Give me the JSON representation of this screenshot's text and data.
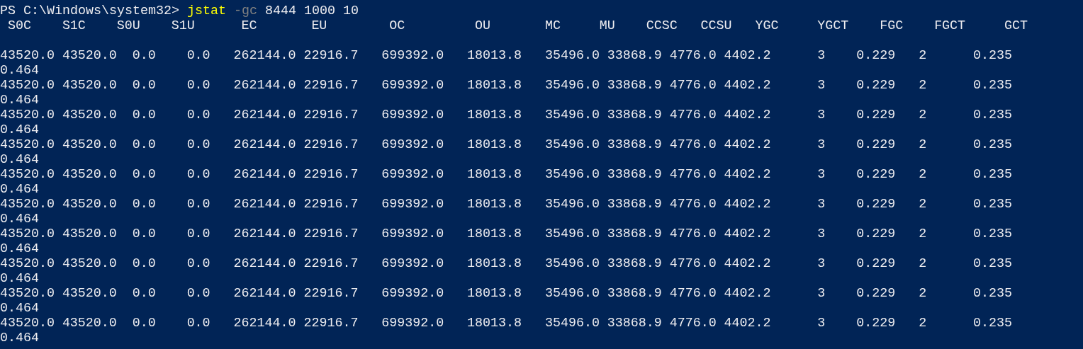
{
  "prompt": {
    "path": "PS C:\\Windows\\system32>",
    "command": "jstat",
    "parameter": "-gc",
    "arguments": "8444 1000 10"
  },
  "output": {
    "header_fields": [
      "S0C",
      "S1C",
      "S0U",
      "S1U",
      "EC",
      "EU",
      "OC",
      "OU",
      "MC",
      "MU",
      "CCSC",
      "CCSU",
      "YGC",
      "YGCT",
      "FGC",
      "FGCT",
      "GCT"
    ],
    "records": [
      [
        "43520.0",
        "43520.0",
        "0.0",
        "0.0",
        "262144.0",
        "22916.7",
        "699392.0",
        "18013.8",
        "35496.0",
        "33868.9",
        "4776.0",
        "4402.2",
        "3",
        "0.229",
        "2",
        "0.235",
        "0.464"
      ],
      [
        "43520.0",
        "43520.0",
        "0.0",
        "0.0",
        "262144.0",
        "22916.7",
        "699392.0",
        "18013.8",
        "35496.0",
        "33868.9",
        "4776.0",
        "4402.2",
        "3",
        "0.229",
        "2",
        "0.235",
        "0.464"
      ],
      [
        "43520.0",
        "43520.0",
        "0.0",
        "0.0",
        "262144.0",
        "22916.7",
        "699392.0",
        "18013.8",
        "35496.0",
        "33868.9",
        "4776.0",
        "4402.2",
        "3",
        "0.229",
        "2",
        "0.235",
        "0.464"
      ],
      [
        "43520.0",
        "43520.0",
        "0.0",
        "0.0",
        "262144.0",
        "22916.7",
        "699392.0",
        "18013.8",
        "35496.0",
        "33868.9",
        "4776.0",
        "4402.2",
        "3",
        "0.229",
        "2",
        "0.235",
        "0.464"
      ],
      [
        "43520.0",
        "43520.0",
        "0.0",
        "0.0",
        "262144.0",
        "22916.7",
        "699392.0",
        "18013.8",
        "35496.0",
        "33868.9",
        "4776.0",
        "4402.2",
        "3",
        "0.229",
        "2",
        "0.235",
        "0.464"
      ],
      [
        "43520.0",
        "43520.0",
        "0.0",
        "0.0",
        "262144.0",
        "22916.7",
        "699392.0",
        "18013.8",
        "35496.0",
        "33868.9",
        "4776.0",
        "4402.2",
        "3",
        "0.229",
        "2",
        "0.235",
        "0.464"
      ],
      [
        "43520.0",
        "43520.0",
        "0.0",
        "0.0",
        "262144.0",
        "22916.7",
        "699392.0",
        "18013.8",
        "35496.0",
        "33868.9",
        "4776.0",
        "4402.2",
        "3",
        "0.229",
        "2",
        "0.235",
        "0.464"
      ],
      [
        "43520.0",
        "43520.0",
        "0.0",
        "0.0",
        "262144.0",
        "22916.7",
        "699392.0",
        "18013.8",
        "35496.0",
        "33868.9",
        "4776.0",
        "4402.2",
        "3",
        "0.229",
        "2",
        "0.235",
        "0.464"
      ],
      [
        "43520.0",
        "43520.0",
        "0.0",
        "0.0",
        "262144.0",
        "22916.7",
        "699392.0",
        "18013.8",
        "35496.0",
        "33868.9",
        "4776.0",
        "4402.2",
        "3",
        "0.229",
        "2",
        "0.235",
        "0.464"
      ],
      [
        "43520.0",
        "43520.0",
        "0.0",
        "0.0",
        "262144.0",
        "22916.7",
        "699392.0",
        "18013.8",
        "35496.0",
        "33868.9",
        "4776.0",
        "4402.2",
        "3",
        "0.229",
        "2",
        "0.235",
        "0.464"
      ]
    ]
  }
}
